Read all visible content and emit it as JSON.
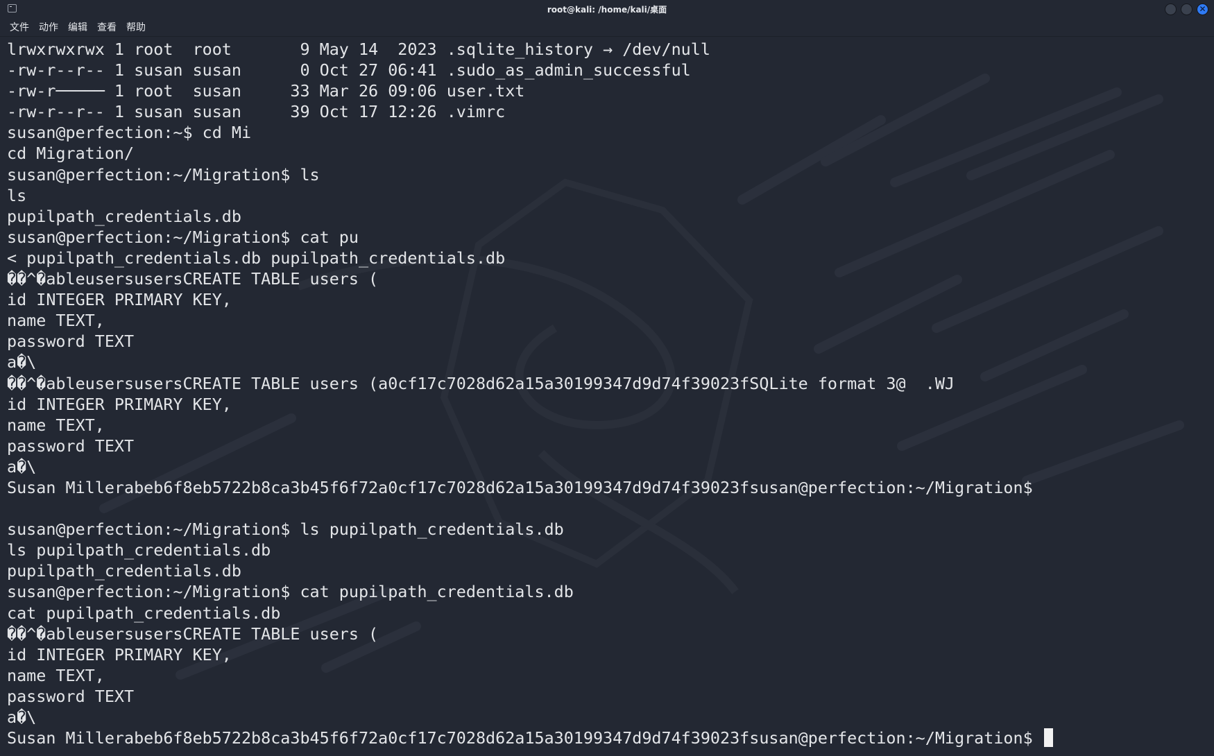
{
  "window": {
    "title": "root@kali: /home/kali/桌面"
  },
  "menu": [
    "文件",
    "动作",
    "编辑",
    "查看",
    "帮助"
  ],
  "colors": {
    "background": "#232833",
    "text": "#e3e5e8",
    "close_button": "#2f7bf5"
  },
  "terminal": {
    "lines": [
      "lrwxrwxrwx 1 root  root       9 May 14  2023 .sqlite_history → /dev/null",
      "-rw-r--r-- 1 susan susan      0 Oct 27 06:41 .sudo_as_admin_successful",
      "-rw-r───── 1 root  susan     33 Mar 26 09:06 user.txt",
      "-rw-r--r-- 1 susan susan     39 Oct 17 12:26 .vimrc",
      "susan@perfection:~$ cd Mi",
      "cd Migration/",
      "susan@perfection:~/Migration$ ls",
      "ls",
      "pupilpath_credentials.db",
      "susan@perfection:~/Migration$ cat pu",
      "< pupilpath_credentials.db pupilpath_credentials.db",
      "��^�ableusersusersCREATE TABLE users (",
      "id INTEGER PRIMARY KEY,",
      "name TEXT,",
      "password TEXT",
      "a�\\",
      "��^�ableusersusersCREATE TABLE users (a0cf17c7028d62a15a30199347d9d74f39023fSQLite format 3@  .WJ",
      "id INTEGER PRIMARY KEY,",
      "name TEXT,",
      "password TEXT",
      "a�\\",
      "Susan Millerabeb6f8eb5722b8ca3b45f6f72a0cf17c7028d62a15a30199347d9d74f39023fsusan@perfection:~/Migration$",
      "",
      "susan@perfection:~/Migration$ ls pupilpath_credentials.db",
      "ls pupilpath_credentials.db",
      "pupilpath_credentials.db",
      "susan@perfection:~/Migration$ cat pupilpath_credentials.db",
      "cat pupilpath_credentials.db",
      "��^�ableusersusersCREATE TABLE users (",
      "id INTEGER PRIMARY KEY,",
      "name TEXT,",
      "password TEXT",
      "a�\\",
      "Susan Millerabeb6f8eb5722b8ca3b45f6f72a0cf17c7028d62a15a30199347d9d74f39023fsusan@perfection:~/Migration$ "
    ]
  }
}
